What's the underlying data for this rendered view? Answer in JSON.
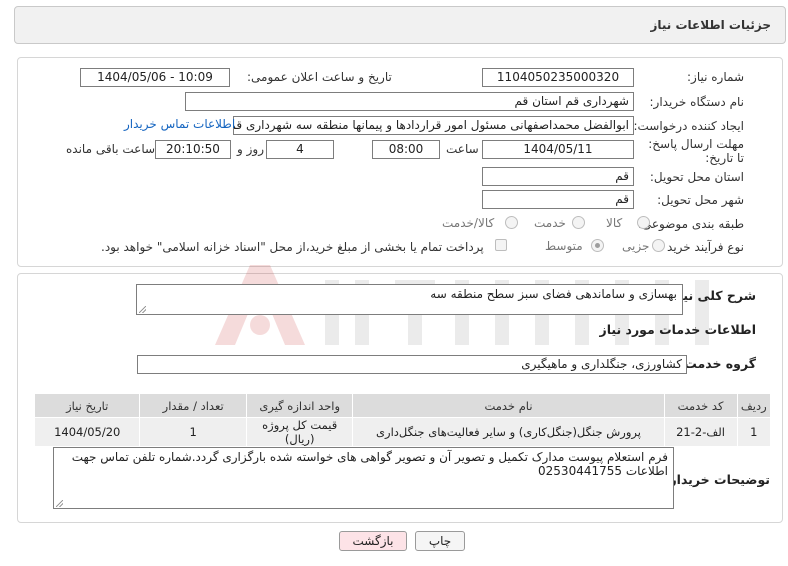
{
  "header": {
    "title": "جزئیات اطلاعات نیاز"
  },
  "labels": {
    "need_number": "شماره نیاز:",
    "announce_datetime": "تاریخ و ساعت اعلان عمومی:",
    "buyer_org": "نام دستگاه خریدار:",
    "requester": "ایجاد کننده درخواست:",
    "deadline": "مهلت ارسال پاسخ: تا تاریخ:",
    "time": "ساعت",
    "day_and": "روز و",
    "time_left": "ساعت باقی مانده",
    "delivery_province": "استان محل تحویل:",
    "delivery_city": "شهر محل تحویل:",
    "category": "طبقه بندی موضوعی:",
    "purchase_type": "نوع فرآیند خرید :",
    "general_description": "شرح کلی نیاز:",
    "services_info": "اطلاعات خدمات مورد نیاز",
    "service_group": "گروه خدمت:",
    "buyer_notes": "توضیحات خریدار:"
  },
  "values": {
    "need_number": "1104050235000320",
    "announce_datetime": "1404/05/06 - 10:09",
    "buyer_org": "شهرداری قم استان قم",
    "requester": "ابوالفضل محمداصفهانی مسئول امور قراردادها و پیمانها منطقه سه شهرداری قم",
    "contact_link": "اطلاعات تماس خریدار",
    "deadline_date": "1404/05/11",
    "deadline_time": "08:00",
    "days": "4",
    "remaining_time": "20:10:50",
    "delivery_province": "قم",
    "delivery_city": "قم",
    "general_description": "بهسازی و ساماندهی فضای سبز سطح منطقه سه",
    "service_group": "کشاورزی، جنگلداری و ماهیگیری",
    "buyer_notes": "فرم استعلام پیوست مدارک تکمیل و تصویر آن و تصویر گواهی های خواسته شده بارگزاری گردد.شماره تلفن تماس جهت اطلاعات 02530441755"
  },
  "category_options": [
    {
      "label": "کالا",
      "selected": false
    },
    {
      "label": "خدمت",
      "selected": false
    },
    {
      "label": "کالا/خدمت",
      "selected": false
    }
  ],
  "purchase_options": [
    {
      "label": "جزیی",
      "selected": false
    },
    {
      "label": "متوسط",
      "selected": true
    }
  ],
  "payment_note": "پرداخت تمام یا بخشی از مبلغ خرید،از محل \"اسناد خزانه اسلامی\" خواهد بود.",
  "table": {
    "headers": [
      "ردیف",
      "کد خدمت",
      "نام خدمت",
      "واحد اندازه گیری",
      "تعداد / مقدار",
      "تاریخ نیاز"
    ],
    "rows": [
      [
        "1",
        "الف-2-21",
        "پرورش جنگل(جنگل‌کاری) و سایر فعالیت‌های جنگل‌داری",
        "قیمت کل پروژه (ریال)",
        "1",
        "1404/05/20"
      ]
    ]
  },
  "buttons": {
    "print": "چاپ",
    "back": "بازگشت"
  }
}
